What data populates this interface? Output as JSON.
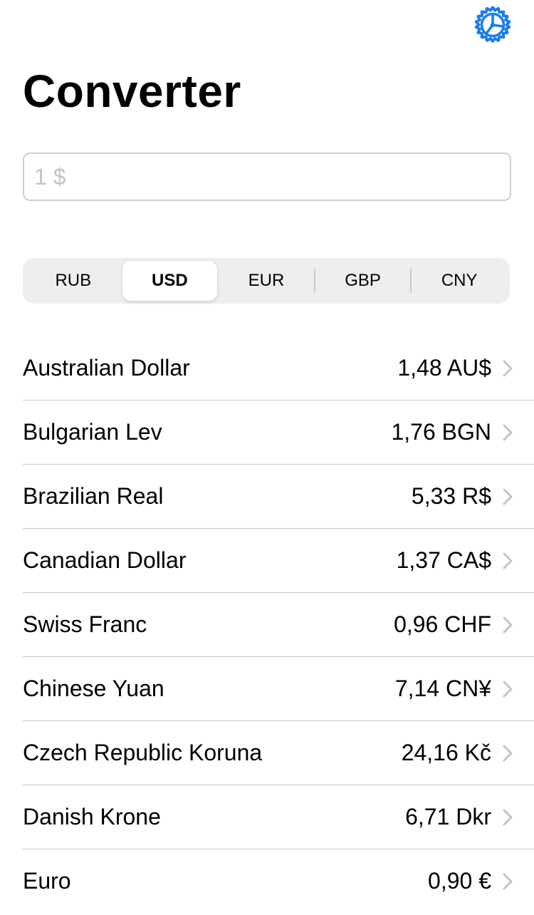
{
  "header": {
    "title": "Converter",
    "settings_icon": "gear-icon",
    "accent_color": "#1a7cf0"
  },
  "amount_input": {
    "placeholder": "1 $",
    "value": ""
  },
  "currency_selector": {
    "options": [
      "RUB",
      "USD",
      "EUR",
      "GBP",
      "CNY"
    ],
    "selected": "USD"
  },
  "rates": [
    {
      "name": "Australian Dollar",
      "value": "1,48 AU$"
    },
    {
      "name": "Bulgarian Lev",
      "value": "1,76 BGN"
    },
    {
      "name": "Brazilian Real",
      "value": "5,33 R$"
    },
    {
      "name": "Canadian Dollar",
      "value": "1,37 CA$"
    },
    {
      "name": "Swiss Franc",
      "value": "0,96 CHF"
    },
    {
      "name": "Chinese Yuan",
      "value": "7,14 CN¥"
    },
    {
      "name": "Czech Republic Koruna",
      "value": "24,16 Kč"
    },
    {
      "name": "Danish Krone",
      "value": "6,71 Dkr"
    },
    {
      "name": "Euro",
      "value": "0,90 €"
    }
  ]
}
